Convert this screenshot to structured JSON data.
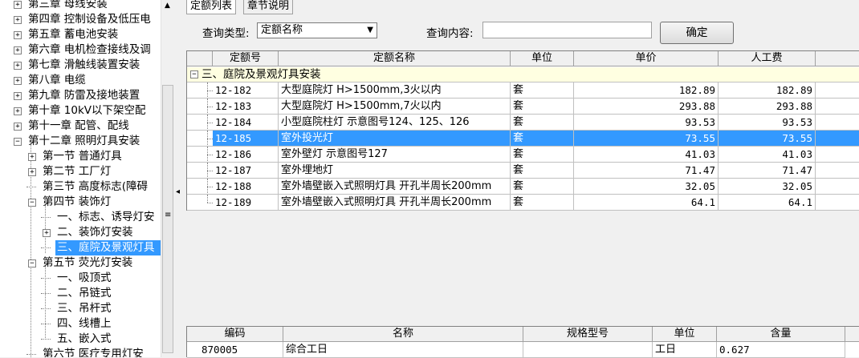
{
  "tree": {
    "items": [
      {
        "label": "第三章 母线安装",
        "expander": "+"
      },
      {
        "label": "第四章 控制设备及低压电",
        "expander": "+"
      },
      {
        "label": "第五章 蓄电池安装",
        "expander": "+"
      },
      {
        "label": "第六章 电机检查接线及调",
        "expander": "+"
      },
      {
        "label": "第七章 滑触线装置安装",
        "expander": "+"
      },
      {
        "label": "第八章 电缆",
        "expander": "+"
      },
      {
        "label": "第九章 防雷及接地装置",
        "expander": "+"
      },
      {
        "label": "第十章 10kV以下架空配",
        "expander": "+"
      },
      {
        "label": "第十一章 配管、配线",
        "expander": "+"
      },
      {
        "label": "第十二章 照明灯具安装",
        "expander": "−"
      },
      {
        "label": "第一节 普通灯具",
        "expander": "+"
      },
      {
        "label": "第二节 工厂灯",
        "expander": "+"
      },
      {
        "label": "第三节 高度标志(障碍",
        "expander": ""
      },
      {
        "label": "第四节 装饰灯",
        "expander": "−"
      },
      {
        "label": "一、标志、诱导灯安",
        "expander": ""
      },
      {
        "label": "二、装饰灯安装",
        "expander": "+"
      },
      {
        "label": "三、庭院及景观灯具",
        "expander": ""
      },
      {
        "label": "第五节 荧光灯安装",
        "expander": "−"
      },
      {
        "label": "一、吸顶式",
        "expander": ""
      },
      {
        "label": "二、吊链式",
        "expander": ""
      },
      {
        "label": "三、吊杆式",
        "expander": ""
      },
      {
        "label": "四、线槽上",
        "expander": ""
      },
      {
        "label": "五、嵌入式",
        "expander": ""
      },
      {
        "label": "第六节 医疗专用灯安",
        "expander": ""
      }
    ]
  },
  "tabs": [
    "定额列表",
    "章节说明"
  ],
  "query": {
    "type_label": "查询类型:",
    "type_value": "定额名称",
    "content_label": "查询内容:",
    "content_value": "",
    "ok_label": "确定"
  },
  "grid": {
    "headers": [
      "定额号",
      "定额名称",
      "单位",
      "单价",
      "人工费"
    ],
    "group_label": "三、庭院及景观灯具安装",
    "group_expander": "−",
    "rows": [
      {
        "code": "12-182",
        "name": "大型庭院灯 H>1500mm,3火以内",
        "unit": "套",
        "price": "182.89",
        "labor": "182.89"
      },
      {
        "code": "12-183",
        "name": "大型庭院灯 H>1500mm,7火以内",
        "unit": "套",
        "price": "293.88",
        "labor": "293.88"
      },
      {
        "code": "12-184",
        "name": "小型庭院柱灯 示意图号124、125、126",
        "unit": "套",
        "price": "93.53",
        "labor": "93.53"
      },
      {
        "code": "12-185",
        "name": "室外投光灯",
        "unit": "套",
        "price": "73.55",
        "labor": "73.55"
      },
      {
        "code": "12-186",
        "name": "室外壁灯 示意图号127",
        "unit": "套",
        "price": "41.03",
        "labor": "41.03"
      },
      {
        "code": "12-187",
        "name": "室外埋地灯",
        "unit": "套",
        "price": "71.47",
        "labor": "71.47"
      },
      {
        "code": "12-188",
        "name": "室外墙壁嵌入式照明灯具 开孔半周长200mm",
        "unit": "套",
        "price": "32.05",
        "labor": "32.05"
      },
      {
        "code": "12-189",
        "name": "室外墙壁嵌入式照明灯具 开孔半周长200mm",
        "unit": "套",
        "price": "64.1",
        "labor": "64.1"
      }
    ]
  },
  "bottom_grid": {
    "headers": [
      "编码",
      "名称",
      "规格型号",
      "单位",
      "含量"
    ],
    "rows": [
      {
        "code": "870005",
        "name": "综合工日",
        "spec": "",
        "unit": "工日",
        "amount": "0.627"
      }
    ]
  },
  "colors": {
    "selection": "#3399ff",
    "group_row": "#ffffe1"
  }
}
